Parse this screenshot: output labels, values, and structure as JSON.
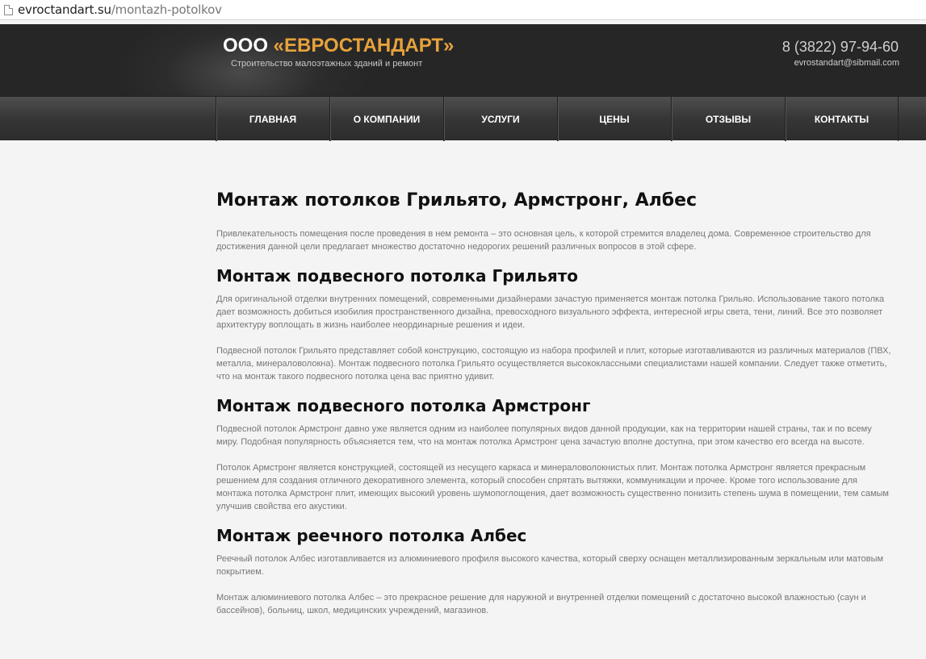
{
  "browser": {
    "url_domain": "evroctandart.su",
    "url_path": "/montazh-potolkov"
  },
  "header": {
    "logo_prefix": "ООО ",
    "logo_brand": "«ЕВРОСТАНДАРТ»",
    "subtitle": "Строительство малоэтажных зданий и ремонт",
    "phone": "8 (3822) 97-94-60",
    "email": "evrostandart@sibmail.com"
  },
  "nav": {
    "items": [
      {
        "label": "ГЛАВНАЯ"
      },
      {
        "label": "О КОМПАНИИ"
      },
      {
        "label": "УСЛУГИ"
      },
      {
        "label": "ЦЕНЫ"
      },
      {
        "label": "ОТЗЫВЫ"
      },
      {
        "label": "КОНТАКТЫ"
      }
    ]
  },
  "article": {
    "title": "Монтаж потолков Грильято, Армстронг, Албес",
    "intro": "Привлекательность помещения после проведения в нем ремонта – это основная цель, к которой стремится владелец дома. Современное строительство для достижения данной цели предлагает множество достаточно недорогих решений различных вопросов в этой сфере.",
    "sections": [
      {
        "heading": "Монтаж подвесного потолка Грильято",
        "paragraphs": [
          "Для оригинальной отделки внутренних помещений, современными дизайнерами зачастую применяется монтаж потолка Грильяо. Использование такого потолка дает возможность добиться изобилия пространственного дизайна, превосходного визуального эффекта, интересной игры света, тени, линий. Все это позволяет архитектуру воплощать в жизнь наиболее неординарные решения и идеи.",
          "Подвесной потолок Грильято представляет собой конструкцию, состоящую из набора профилей и плит, которые изготавливаются из различных материалов (ПВХ, металла, минераловолокна). Монтаж подвесного потолка Грильято осуществляется высококлассными специалистами нашей компании. Следует также отметить, что на монтаж такого подвесного потолка цена вас приятно удивит."
        ]
      },
      {
        "heading": "Монтаж подвесного потолка Армстронг",
        "paragraphs": [
          "Подвесной потолок Армстронг давно уже является одним из наиболее популярных видов данной продукции, как на территории нашей страны, так и по всему миру. Подобная популярность объясняется тем, что на монтаж потолка Армстронг цена зачастую вполне доступна, при этом качество его всегда на высоте.",
          "Потолок Армстронг является конструкцией, состоящей из несущего каркаса и минераловолокнистых плит. Монтаж потолка Армстронг является прекрасным решением для создания отличного декоративного элемента, который способен спрятать вытяжки, коммуникации и прочее. Кроме того использование для  монтажа потолка Армстронг плит, имеющих высокий уровень шумопоглощения, дает возможность существенно понизить степень шума в помещении, тем самым улучшив свойства его акустики."
        ]
      },
      {
        "heading": "Монтаж реечного потолка Албес",
        "paragraphs": [
          "Реечный потолок Албес изготавливается из алюминиевого профиля высокого качества, который сверху оснащен металлизированным зеркальным или матовым покрытием.",
          "Монтаж алюминиевого потолка Албес – это прекрасное решение для наружной и внутренней отделки помещений с достаточно высокой влажностью (саун и бассейнов), больниц, школ, медицинских учреждений, магазинов."
        ]
      }
    ]
  }
}
